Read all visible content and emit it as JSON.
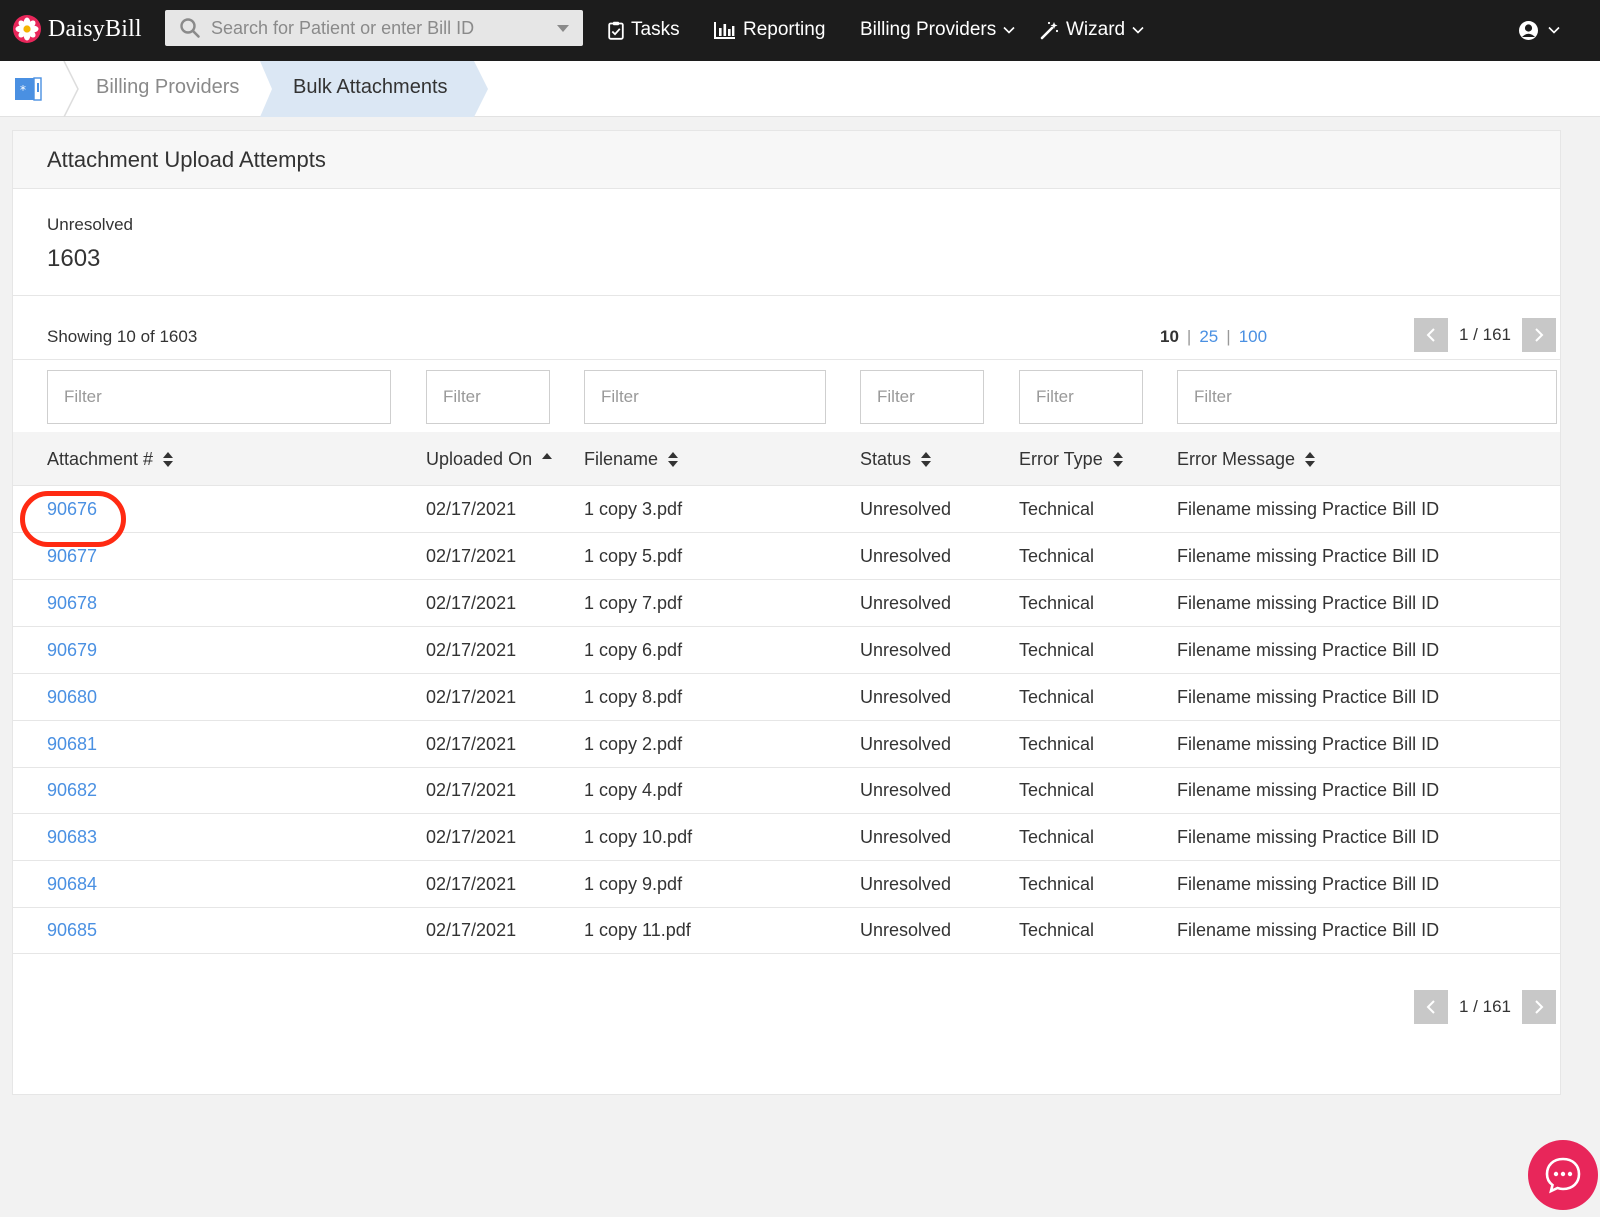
{
  "app": {
    "name": "DaisyBill"
  },
  "topnav": {
    "search_placeholder": "Search for Patient or enter Bill ID",
    "items": [
      {
        "label": "Tasks",
        "icon": "clipboard-check-icon"
      },
      {
        "label": "Reporting",
        "icon": "bar-chart-icon"
      },
      {
        "label": "Billing Providers",
        "icon": "chevron-down-icon"
      },
      {
        "label": "Wizard",
        "icon": "magic-wand-icon"
      }
    ],
    "user_icon": "user-circle-icon"
  },
  "breadcrumb": [
    {
      "label": "Billing Providers"
    },
    {
      "label": "Bulk Attachments"
    }
  ],
  "card": {
    "title": "Attachment Upload Attempts",
    "summary": {
      "label": "Unresolved",
      "value": "1603"
    },
    "showing": "Showing 10 of 1603",
    "per_page": {
      "selected": "10",
      "options": [
        "25",
        "100"
      ]
    },
    "pager": {
      "text": "1 / 161"
    }
  },
  "filters": [
    {
      "placeholder": "Filter"
    },
    {
      "placeholder": "Filter"
    },
    {
      "placeholder": "Filter"
    },
    {
      "placeholder": "Filter"
    },
    {
      "placeholder": "Filter"
    },
    {
      "placeholder": "Filter"
    }
  ],
  "table": {
    "columns": [
      "Attachment #",
      "Uploaded On",
      "Filename",
      "Status",
      "Error Type",
      "Error Message"
    ],
    "rows": [
      {
        "id": "90676",
        "uploaded": "02/17/2021",
        "filename": "1 copy 3.pdf",
        "status": "Unresolved",
        "error_type": "Technical",
        "error_message": "Filename missing Practice Bill ID"
      },
      {
        "id": "90677",
        "uploaded": "02/17/2021",
        "filename": "1 copy 5.pdf",
        "status": "Unresolved",
        "error_type": "Technical",
        "error_message": "Filename missing Practice Bill ID"
      },
      {
        "id": "90678",
        "uploaded": "02/17/2021",
        "filename": "1 copy 7.pdf",
        "status": "Unresolved",
        "error_type": "Technical",
        "error_message": "Filename missing Practice Bill ID"
      },
      {
        "id": "90679",
        "uploaded": "02/17/2021",
        "filename": "1 copy 6.pdf",
        "status": "Unresolved",
        "error_type": "Technical",
        "error_message": "Filename missing Practice Bill ID"
      },
      {
        "id": "90680",
        "uploaded": "02/17/2021",
        "filename": "1 copy 8.pdf",
        "status": "Unresolved",
        "error_type": "Technical",
        "error_message": "Filename missing Practice Bill ID"
      },
      {
        "id": "90681",
        "uploaded": "02/17/2021",
        "filename": "1 copy 2.pdf",
        "status": "Unresolved",
        "error_type": "Technical",
        "error_message": "Filename missing Practice Bill ID"
      },
      {
        "id": "90682",
        "uploaded": "02/17/2021",
        "filename": "1 copy 4.pdf",
        "status": "Unresolved",
        "error_type": "Technical",
        "error_message": "Filename missing Practice Bill ID"
      },
      {
        "id": "90683",
        "uploaded": "02/17/2021",
        "filename": "1 copy 10.pdf",
        "status": "Unresolved",
        "error_type": "Technical",
        "error_message": "Filename missing Practice Bill ID"
      },
      {
        "id": "90684",
        "uploaded": "02/17/2021",
        "filename": "1 copy 9.pdf",
        "status": "Unresolved",
        "error_type": "Technical",
        "error_message": "Filename missing Practice Bill ID"
      },
      {
        "id": "90685",
        "uploaded": "02/17/2021",
        "filename": "1 copy 11.pdf",
        "status": "Unresolved",
        "error_type": "Technical",
        "error_message": "Filename missing Practice Bill ID"
      }
    ]
  },
  "colors": {
    "accent": "#4a90e2",
    "highlight": "#ff2a12",
    "chat": "#e8265a",
    "nav_bg": "#1c1c1c"
  }
}
